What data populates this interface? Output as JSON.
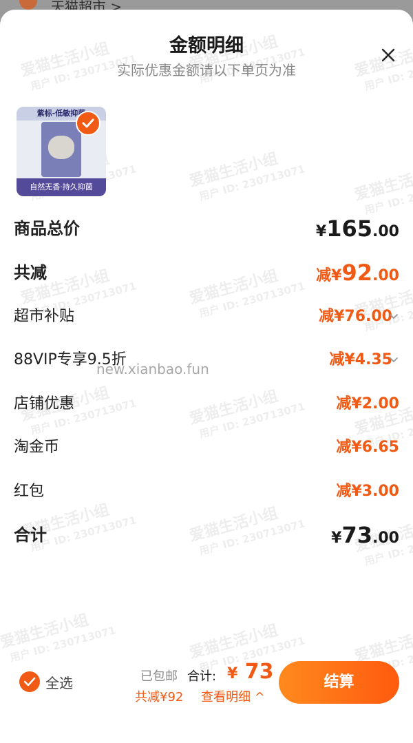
{
  "topbar": {
    "shop_name": "天猫超市 >"
  },
  "header": {
    "title": "金额明细",
    "subtitle": "实际优惠金额请以下单页为准"
  },
  "product": {
    "label_top": "紫标-低敏抑菌",
    "label_bottom": "自然无香·持久抑菌"
  },
  "summary": {
    "goods_total": {
      "label": "商品总价",
      "currency": "¥",
      "integer": "165",
      "decimal": ".00"
    },
    "total_discount": {
      "label": "共减",
      "prefix": "减",
      "currency": "¥",
      "integer": "92",
      "decimal": ".00"
    }
  },
  "discounts": [
    {
      "label": "超市补贴",
      "amount": "减¥76.00",
      "expandable": true
    },
    {
      "label": "88VIP专享9.5折",
      "amount": "减¥4.35",
      "expandable": true
    },
    {
      "label": "店铺优惠",
      "amount": "减¥2.00",
      "expandable": false
    },
    {
      "label": "淘金币",
      "amount": "减¥6.65",
      "expandable": false
    },
    {
      "label": "红包",
      "amount": "减¥3.00",
      "expandable": false
    }
  ],
  "grand_total": {
    "label": "合计",
    "currency": "¥",
    "integer": "73",
    "decimal": ".00"
  },
  "watermark": {
    "text": "爱猫生活小组",
    "user_id": "用户 ID: 230713071"
  },
  "overlay_url": "new.xianbao.fun",
  "bottom_bar": {
    "select_all": "全选",
    "shipping": "已包邮",
    "total_label": "合计:",
    "total_currency": "¥",
    "total_value": "73",
    "discount_text": "共减¥92",
    "detail_link": "查看明细 ^",
    "checkout": "结算"
  },
  "colors": {
    "accent": "#f05a14",
    "checkout_gradient_start": "#ff8a1e",
    "checkout_gradient_end": "#ff5a0e"
  }
}
